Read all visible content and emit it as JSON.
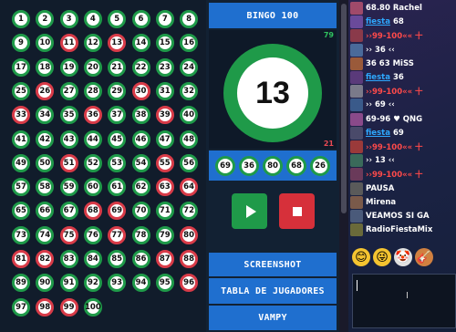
{
  "board": {
    "called": [
      11,
      13,
      26,
      30,
      33,
      36,
      39,
      51,
      55,
      63,
      64,
      68,
      69,
      75,
      77,
      80,
      81,
      82,
      87,
      88,
      96,
      98,
      99
    ],
    "numbers": [
      1,
      2,
      3,
      4,
      5,
      6,
      7,
      8,
      9,
      10,
      11,
      12,
      13,
      14,
      15,
      16,
      17,
      18,
      19,
      20,
      21,
      22,
      23,
      24,
      25,
      26,
      27,
      28,
      29,
      30,
      31,
      32,
      33,
      34,
      35,
      36,
      37,
      38,
      39,
      40,
      41,
      42,
      43,
      44,
      45,
      46,
      47,
      48,
      49,
      50,
      51,
      52,
      53,
      54,
      55,
      56,
      57,
      58,
      59,
      60,
      61,
      62,
      63,
      64,
      65,
      66,
      67,
      68,
      69,
      70,
      71,
      72,
      73,
      74,
      75,
      76,
      77,
      78,
      79,
      80,
      81,
      82,
      83,
      84,
      85,
      86,
      87,
      88,
      89,
      90,
      91,
      92,
      93,
      94,
      95,
      96,
      97,
      98,
      99,
      100
    ]
  },
  "middle": {
    "title": "BINGO 100",
    "remaining_count": "79",
    "called_count": "21",
    "current_number": "13",
    "recent": [
      "69",
      "36",
      "80",
      "68",
      "26"
    ],
    "buttons": {
      "screenshot": "SCREENSHOT",
      "players_table": "TABLA DE JUGADORES",
      "vampy": "VAMPY"
    }
  },
  "chat": {
    "lines": [
      {
        "parts": [
          {
            "t": "68.80 Rachel",
            "c": "wtext"
          }
        ]
      },
      {
        "parts": [
          {
            "t": "fiesta",
            "c": "uname"
          },
          {
            "t": " 68",
            "c": "wtext"
          }
        ]
      },
      {
        "parts": [
          {
            "t": "››99-100«« 十",
            "c": "rtext"
          }
        ]
      },
      {
        "parts": [
          {
            "t": "›› 36 ‹‹",
            "c": "wtext"
          }
        ]
      },
      {
        "parts": [
          {
            "t": "36 63 MiSS",
            "c": "wtext"
          }
        ]
      },
      {
        "parts": [
          {
            "t": "fiesta",
            "c": "uname"
          },
          {
            "t": " 36",
            "c": "wtext"
          }
        ]
      },
      {
        "parts": [
          {
            "t": "››99-100«« 十",
            "c": "rtext"
          }
        ]
      },
      {
        "parts": [
          {
            "t": "›› 69 ‹‹",
            "c": "wtext"
          }
        ]
      },
      {
        "parts": [
          {
            "t": "69-96 ♥ QNG",
            "c": "wtext"
          }
        ]
      },
      {
        "parts": [
          {
            "t": "fiesta",
            "c": "uname"
          },
          {
            "t": " 69",
            "c": "wtext"
          }
        ]
      },
      {
        "parts": [
          {
            "t": "››99-100«« 十",
            "c": "rtext"
          }
        ]
      },
      {
        "parts": [
          {
            "t": "›› 13 ‹‹",
            "c": "wtext"
          }
        ]
      },
      {
        "parts": [
          {
            "t": "››99-100«« 十",
            "c": "rtext"
          }
        ]
      },
      {
        "parts": [
          {
            "t": "PAUSA",
            "c": "wtext"
          }
        ]
      },
      {
        "parts": [
          {
            "t": "Mirena",
            "c": "wtext"
          }
        ]
      },
      {
        "parts": [
          {
            "t": "VEAMOS SI GA",
            "c": "wtext"
          }
        ]
      },
      {
        "parts": [
          {
            "t": "RadioFiestaMix",
            "c": "wtext"
          }
        ]
      }
    ],
    "emojis": [
      "😊",
      "😜",
      "🤡",
      "🎸"
    ]
  },
  "colors": {
    "green": "#1f9a49",
    "red": "#d83b48",
    "blue": "#1f6fcf"
  }
}
